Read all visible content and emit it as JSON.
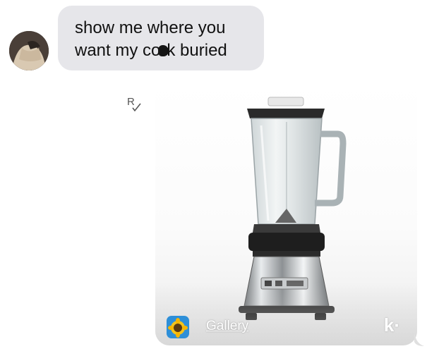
{
  "message_in": {
    "line1": "show me where you",
    "line2_before": "want my co",
    "line2_after": "k buried"
  },
  "read_receipt": "R",
  "attachment": {
    "source_label": "Gallery",
    "brand": "k·"
  },
  "icons": {
    "avatar": "user-avatar",
    "receipt": "read-receipt-icon",
    "app": "sunflower-app-icon"
  },
  "colors": {
    "bubble_in": "#e6e6ea",
    "app_icon": "#2e8fd8"
  }
}
